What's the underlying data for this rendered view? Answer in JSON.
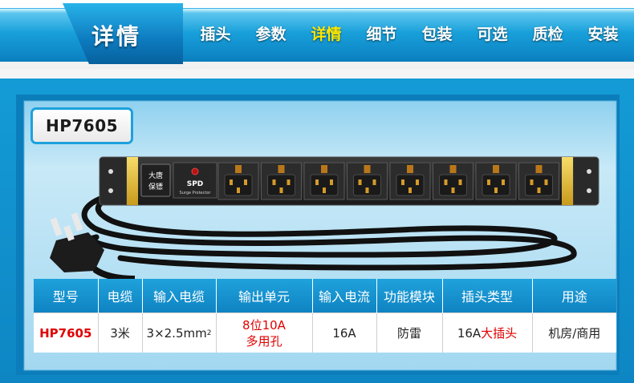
{
  "nav": {
    "current_section": "详情",
    "items": [
      {
        "label": "插头",
        "active": false
      },
      {
        "label": "参数",
        "active": false
      },
      {
        "label": "详情",
        "active": true
      },
      {
        "label": "细节",
        "active": false
      },
      {
        "label": "包装",
        "active": false
      },
      {
        "label": "可选",
        "active": false
      },
      {
        "label": "质检",
        "active": false
      },
      {
        "label": "安装",
        "active": false
      }
    ],
    "colors": {
      "bar": "#0b8fd0",
      "active_text": "#ffe800",
      "text": "#ffffff"
    }
  },
  "product": {
    "model_tag": "HP7605",
    "brand_badge_line1": "大唐",
    "brand_badge_line2": "保镖",
    "spd_label": "SPD",
    "spd_sub": "Surge Protector",
    "outlet_count": 8
  },
  "spec_table": {
    "headers": [
      "型号",
      "电缆",
      "输入电缆",
      "输出单元",
      "输入电流",
      "功能模块",
      "插头类型",
      "用途"
    ],
    "row": {
      "model": "HP7605",
      "cable": "3米",
      "input_cable": "3×2.5mm",
      "input_cable_sup": "2",
      "output_line1": "8位10A",
      "output_line2": "多用孔",
      "current": "16A",
      "module": "防雷",
      "plug_prefix": "16A",
      "plug_highlight": "大插头",
      "usage": "机房/商用"
    }
  }
}
